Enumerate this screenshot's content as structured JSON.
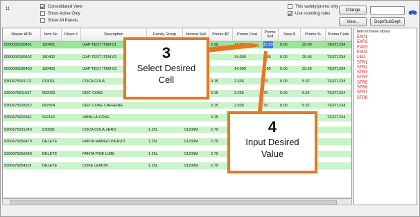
{
  "counter": "11",
  "checkboxes": {
    "consolidated": {
      "label": "Consolidated View",
      "checked": true
    },
    "active_only": {
      "label": "Show Active Only",
      "checked": false
    },
    "all_panels": {
      "label": "Show All Panels",
      "checked": false
    },
    "variety_only": {
      "label": "This variety/promo only",
      "checked": false
    },
    "rounding": {
      "label": "Use rounding rules",
      "checked": true
    }
  },
  "buttons": {
    "change": "Change",
    "view": "View...",
    "dept": "Dept/SubDept"
  },
  "grid": {
    "columns": [
      "Master APN",
      "Item No",
      "Direct #",
      "Description",
      "Family Group",
      "Normal Sell",
      "Promo $P",
      "Promo Cost",
      "Promo Sell",
      "Save $",
      "Promo %",
      "Promo Code",
      "Whouse Off Inv"
    ],
    "rows": [
      [
        "0000000180401",
        "180401",
        "",
        "GAP TEST ITEM 01",
        "",
        "",
        "5.99",
        "14.000",
        "15.99",
        "0.00",
        "29.96",
        "TEST1234",
        ""
      ],
      [
        "0000000180402",
        "180402",
        "",
        "GAP TEST ITEM 02",
        "",
        "",
        "",
        "14.000",
        "9.99",
        "0.00",
        "29.96",
        "TEST1234",
        ""
      ],
      [
        "0000000180403",
        "180403",
        "",
        "GAP TEST ITEM 03",
        "",
        "",
        "",
        "14.000",
        "9.99",
        "0.00",
        "29.96",
        "TEST1234",
        ""
      ],
      [
        "9300675001113",
        "013011",
        "",
        "COCA COLA",
        "",
        "",
        "0.15",
        "2.636",
        "79",
        "0.00",
        "5.52",
        "TEST1234",
        ""
      ],
      [
        "9300675011037",
        "052023",
        "",
        "DIET COKE",
        "",
        "",
        "0.15",
        "2.636",
        "79",
        "0.00",
        "5.52",
        "TEST1234",
        ""
      ],
      [
        "9300675018012",
        "087824",
        "",
        "DIET COKE CAFFEINE",
        "",
        "",
        "0.15",
        "2.636",
        "79",
        "0.00",
        "5.52",
        "TEST1234",
        ""
      ],
      [
        "9300675020961",
        "932118",
        "",
        "VANILLA COKE",
        "",
        "",
        "0.15",
        "2.636",
        "79",
        "0.00",
        "5.52",
        "TEST1234",
        ""
      ],
      [
        "9300675031240",
        "030681",
        "",
        "COCA COLA ZERO",
        "1.25L",
        "01230M",
        "2.79",
        "0.15",
        "2.6",
        "",
        "",
        "",
        ""
      ],
      [
        "9300675050470",
        "DELETE",
        "",
        "FANTA MANGO P/FRUIT",
        "1.25L",
        "01230M",
        "2.79",
        "0.15",
        "2.6",
        "",
        "",
        "",
        ""
      ],
      [
        "9300675050548",
        "DELETE",
        "",
        "FANTA PINE LIME",
        "1.25L",
        "01230M",
        "2.79",
        "0.15",
        "2.6",
        "",
        "",
        "",
        ""
      ],
      [
        "9300675054119",
        "DELETE",
        "",
        "COKE LEMON",
        "1.25L",
        "01230M",
        "2.79",
        "0.15",
        "2.6",
        "",
        "",
        "",
        ""
      ]
    ]
  },
  "stores": {
    "title": "Item in these stores",
    "items": [
      "EXP1",
      "EXP2",
      "EXP3",
      "EXP4",
      "LIG1",
      "STR1",
      "STR2",
      "STR3",
      "STR4",
      "STR5",
      "STR6",
      "STR7",
      "STR8"
    ]
  },
  "callouts": {
    "step3": {
      "number": "3",
      "line1": "Select Desired",
      "line2": "Cell"
    },
    "step4": {
      "number": "4",
      "line1": "Input Desired",
      "line2": "Value"
    }
  },
  "colors": {
    "row": "#c9f3c9",
    "selected_row": "#99e699",
    "accent": "#e87722",
    "store_text": "#d01010"
  }
}
